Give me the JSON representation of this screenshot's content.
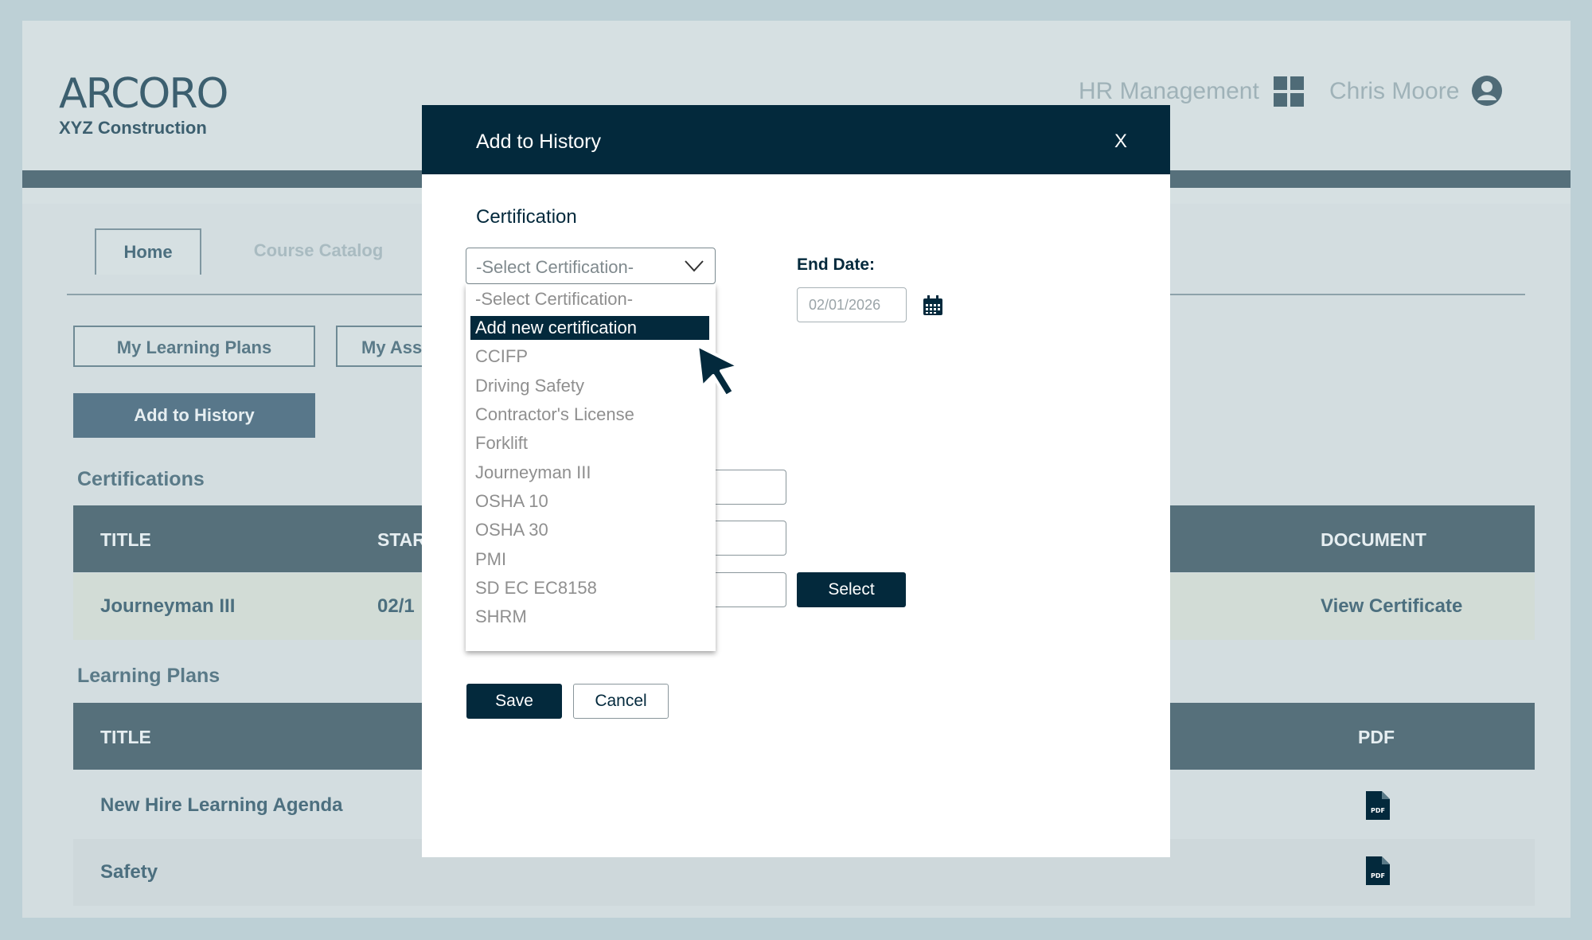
{
  "header": {
    "logo_text": "ARCORO",
    "company": "XYZ Construction",
    "module_label": "HR Management",
    "user_name": "Chris Moore"
  },
  "tabs": [
    {
      "label": "Home",
      "active": true
    },
    {
      "label": "Course Catalog",
      "active": false
    }
  ],
  "sub_nav": {
    "learning_plans_label": "My Learning Plans",
    "assignments_label": "My Ass"
  },
  "add_history_button": "Add to History",
  "certifications": {
    "title": "Certifications",
    "columns": {
      "title": "TITLE",
      "start": "STAR",
      "document": "DOCUMENT"
    },
    "rows": [
      {
        "title": "Journeyman III",
        "start": "02/1",
        "document": "View Certificate"
      }
    ]
  },
  "learning_plans": {
    "title": "Learning Plans",
    "columns": {
      "title": "TITLE",
      "pdf": "PDF"
    },
    "rows": [
      {
        "title": "New Hire Learning Agenda",
        "pdf_icon": "pdf-file-icon"
      },
      {
        "title": "Safety",
        "pdf_icon": "pdf-file-icon"
      }
    ]
  },
  "modal": {
    "title": "Add to History",
    "close_label": "X",
    "certification_label": "Certification",
    "select_value": "-Select Certification-",
    "options": [
      "-Select Certification-",
      "Add new certification",
      "CCIFP",
      "Driving Safety",
      "Contractor's License",
      "Forklift",
      "Journeyman III",
      "OSHA 10",
      "OSHA 30",
      "PMI",
      "SD EC EC8158",
      "SHRM"
    ],
    "highlighted_option": "Add new certification",
    "end_date_label": "End Date:",
    "end_date_placeholder": "02/01/2026",
    "select_button": "Select",
    "save_button": "Save",
    "cancel_button": "Cancel"
  },
  "colors": {
    "primary_dark": "#03293c",
    "header_bar": "#56707b",
    "accent_slate": "#58778a"
  }
}
